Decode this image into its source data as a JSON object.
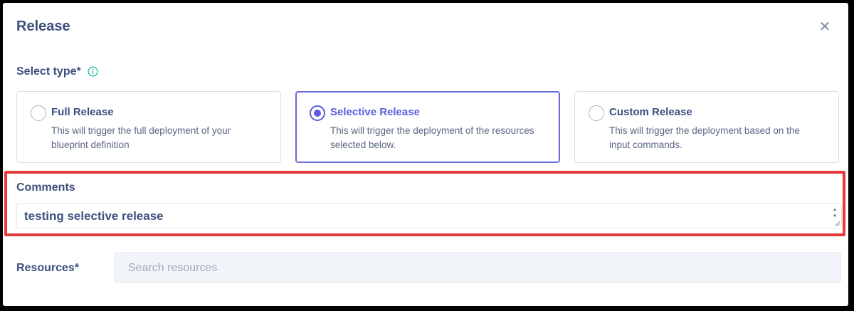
{
  "dialog": {
    "title": "Release",
    "close_icon": "close-icon"
  },
  "select_type": {
    "label": "Select type*",
    "info_icon": "info-icon",
    "options": [
      {
        "title": "Full Release",
        "description": "This will trigger the full deployment of your blueprint definition",
        "selected": false
      },
      {
        "title": "Selective Release",
        "description": "This will trigger the deployment of the resources selected below.",
        "selected": true
      },
      {
        "title": "Custom Release",
        "description": "This will trigger the deployment based on the input commands.",
        "selected": false
      }
    ]
  },
  "comments": {
    "label": "Comments",
    "value": "testing selective release"
  },
  "resources": {
    "label": "Resources*",
    "placeholder": "Search resources"
  },
  "colors": {
    "accent": "#5b5ce0",
    "text_primary": "#3d4f7e",
    "highlight": "#e53b3b",
    "info": "#1fb6a6"
  }
}
